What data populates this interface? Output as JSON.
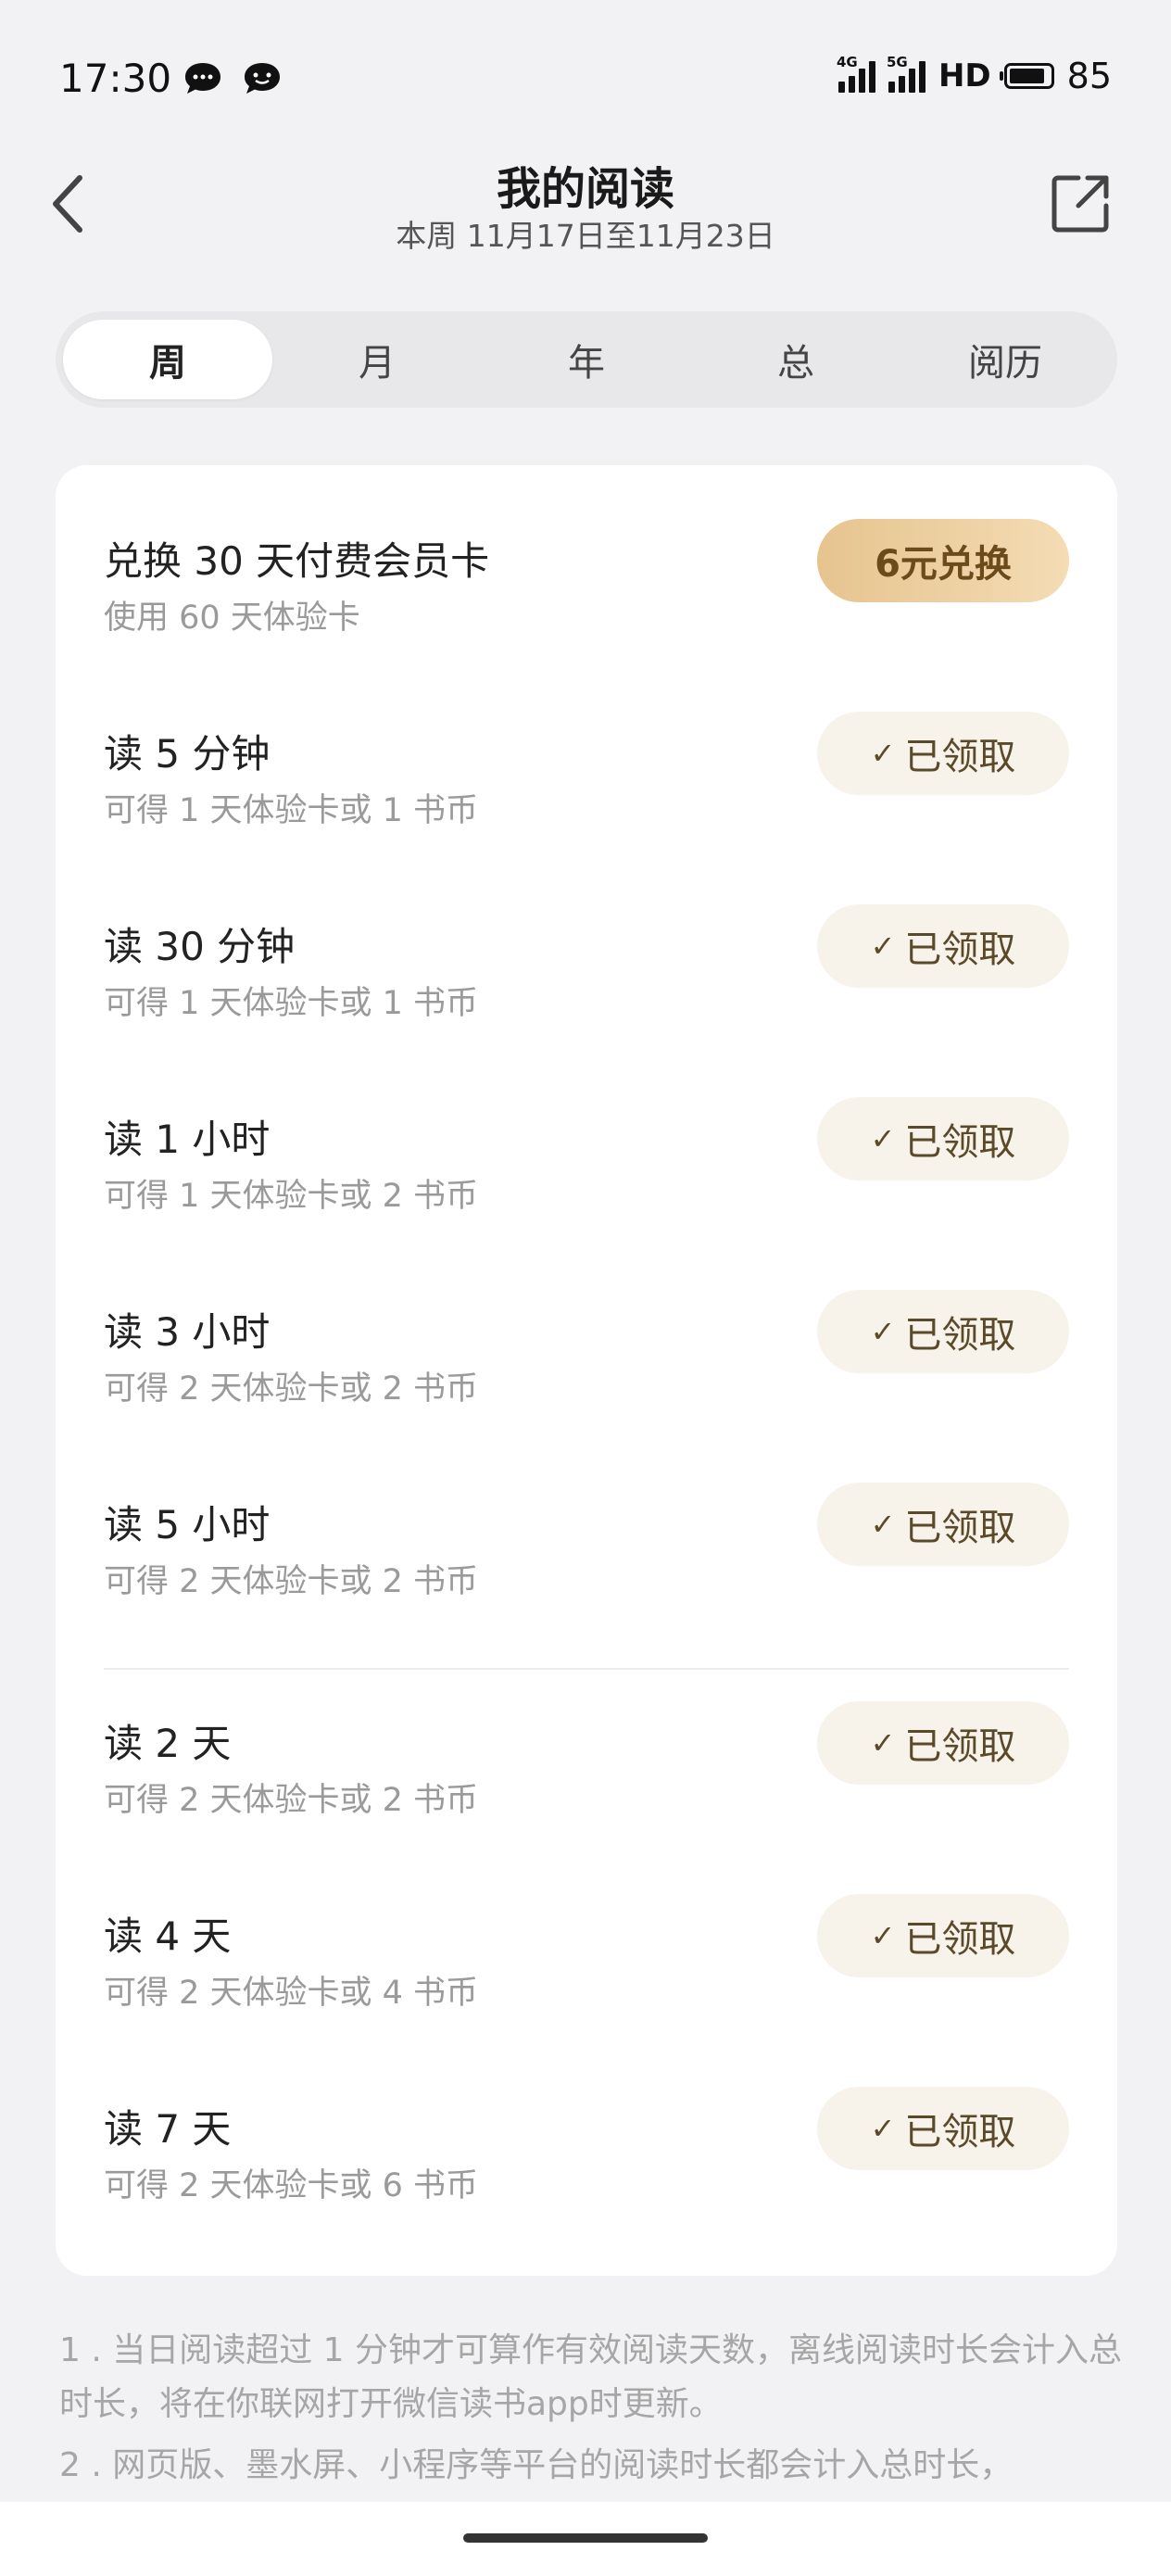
{
  "status_bar": {
    "time": "17:30",
    "notification_icons": [
      "chat-bubble-icon",
      "chat-bubble-icon"
    ],
    "network_1": "4G",
    "network_2": "5G",
    "hd": "HD",
    "battery": "85"
  },
  "header": {
    "title": "我的阅读",
    "subtitle": "本周 11月17日至11月23日",
    "back_icon": "chevron-left-icon",
    "share_icon": "share-external-icon"
  },
  "tabs": [
    {
      "label": "周",
      "active": true
    },
    {
      "label": "月",
      "active": false
    },
    {
      "label": "年",
      "active": false
    },
    {
      "label": "总",
      "active": false
    },
    {
      "label": "阅历",
      "active": false
    }
  ],
  "rewards": [
    {
      "title": "兑换 30 天付费会员卡",
      "subtitle": "使用 60 天体验卡",
      "button": "6元兑换",
      "claimed": false
    },
    {
      "title": "读 5 分钟",
      "subtitle": "可得 1 天体验卡或 1 书币",
      "button": "已领取",
      "claimed": true
    },
    {
      "title": "读 30 分钟",
      "subtitle": "可得 1 天体验卡或 1 书币",
      "button": "已领取",
      "claimed": true
    },
    {
      "title": "读 1 小时",
      "subtitle": "可得 1 天体验卡或 2 书币",
      "button": "已领取",
      "claimed": true
    },
    {
      "title": "读 3 小时",
      "subtitle": "可得 2 天体验卡或 2 书币",
      "button": "已领取",
      "claimed": true
    },
    {
      "title": "读 5 小时",
      "subtitle": "可得 2 天体验卡或 2 书币",
      "button": "已领取",
      "claimed": true
    },
    {
      "title": "读 2 天",
      "subtitle": "可得 2 天体验卡或 2 书币",
      "button": "已领取",
      "claimed": true
    },
    {
      "title": "读 4 天",
      "subtitle": "可得 2 天体验卡或 4 书币",
      "button": "已领取",
      "claimed": true
    },
    {
      "title": "读 7 天",
      "subtitle": "可得 2 天体验卡或 6 书币",
      "button": "已领取",
      "claimed": true
    }
  ],
  "check_icon": "✓",
  "notes": [
    "1 . 当日阅读超过 1 分钟才可算作有效阅读天数，离线阅读时长会计入总时长，将在你联网打开微信读书app时更新。",
    "2 . 网页版、墨水屏、小程序等平台的阅读时长都会计入总时长，"
  ],
  "colors": {
    "background": "#f2f2f4",
    "card": "#ffffff",
    "claimed_button_bg": "#f7f3ea",
    "gold_button_start": "#e6c48f",
    "gold_button_end": "#f4dcb4"
  }
}
